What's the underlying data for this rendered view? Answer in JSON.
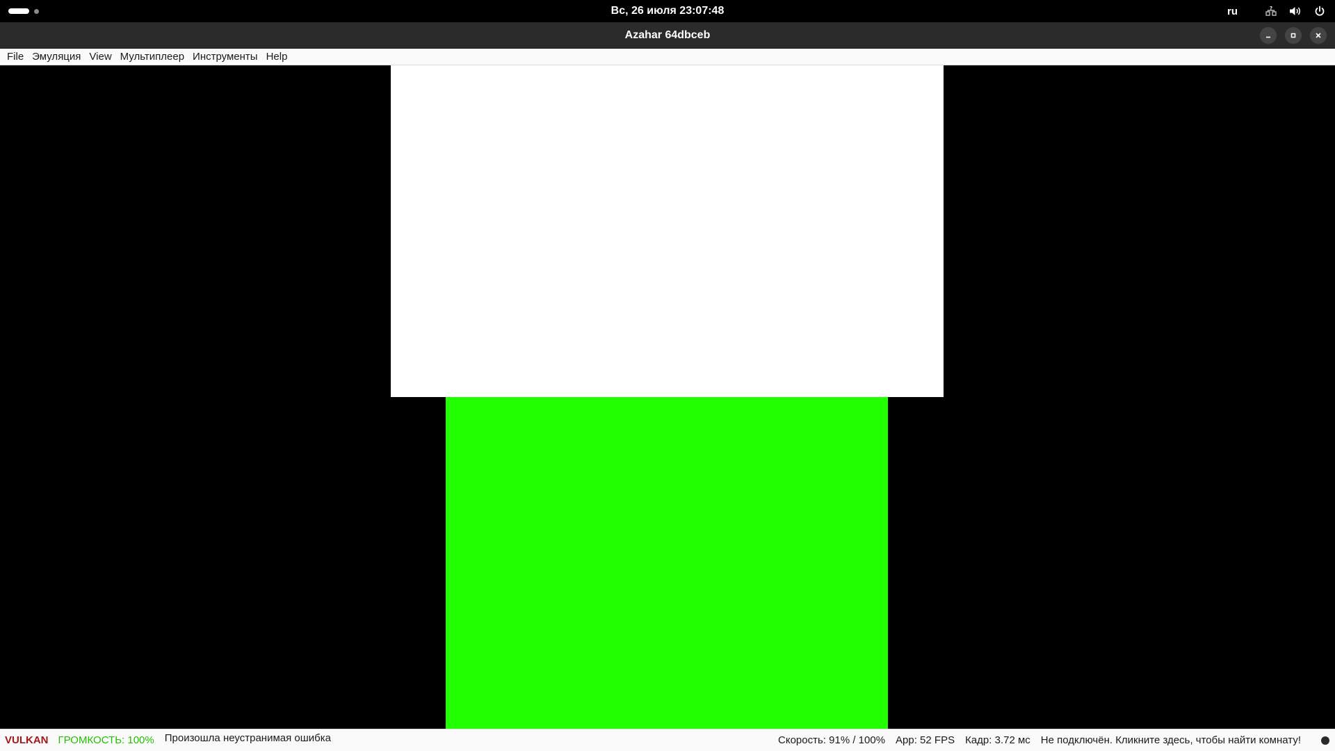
{
  "topbar": {
    "clock": "Вс, 26 июля  23:07:48",
    "keyboard_layout": "ru",
    "icons": [
      "network-question-icon",
      "volume-icon",
      "power-icon"
    ]
  },
  "window": {
    "title": "Azahar 64dbceb",
    "controls": [
      "minimize-icon",
      "maximize-icon",
      "close-icon"
    ]
  },
  "menu": {
    "items": [
      {
        "label": "File"
      },
      {
        "label": "Эмуляция"
      },
      {
        "label": "View"
      },
      {
        "label": "Мультиплеер"
      },
      {
        "label": "Инструменты"
      },
      {
        "label": "Help"
      }
    ]
  },
  "screens": {
    "top_color": "#ffffff",
    "bottom_color": "#22ff00"
  },
  "status": {
    "api": "VULKAN",
    "volume": "ГРОМКОСТЬ: 100%",
    "message": "Произошла неустранимая ошибка",
    "speed": "Скорость: 91% / 100%",
    "app_fps": "App: 52 FPS",
    "frame_time": "Кадр: 3.72 мс",
    "network": "Не подключён. Кликните здесь, чтобы найти комнату!",
    "colors": {
      "api": "#a01818",
      "volume": "#22c000"
    }
  }
}
